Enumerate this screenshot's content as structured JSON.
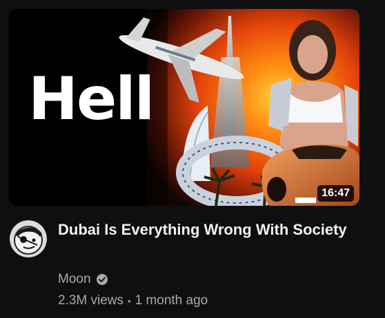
{
  "video": {
    "thumbnail_text": "Hell",
    "duration": "16:47",
    "title": "Dubai Is Everything Wrong With Society",
    "channel": "Moon",
    "verified_icon": "check-circle-icon",
    "views": "2.3M views",
    "separator": "•",
    "age": "1 month ago"
  },
  "colors": {
    "background": "#0f0f0f",
    "title": "#f1f1f1",
    "secondary": "#aaaaaa"
  }
}
